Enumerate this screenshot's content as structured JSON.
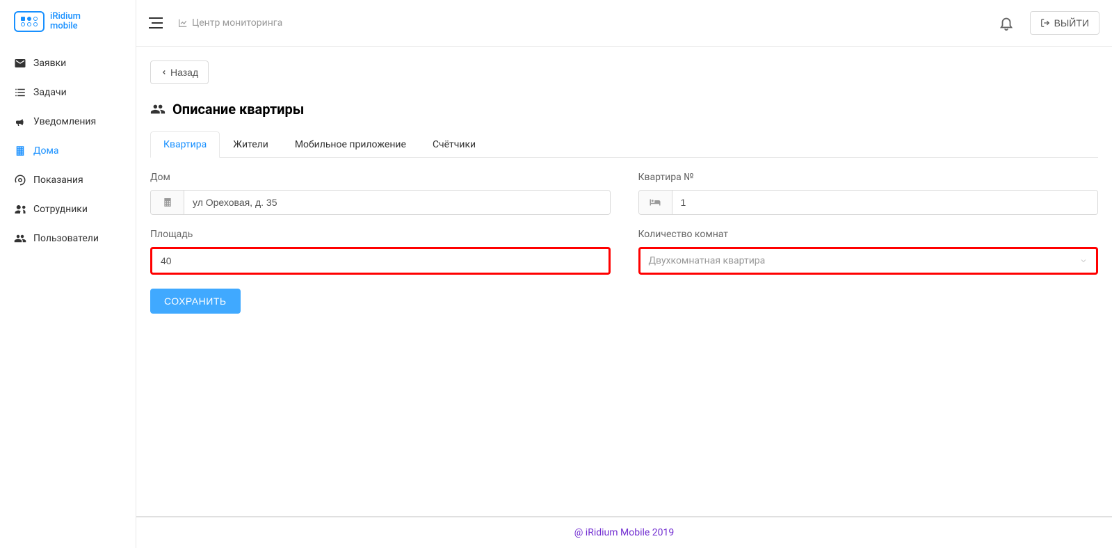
{
  "brand": {
    "line1": "iRidium",
    "line2": "mobile"
  },
  "sidebar": {
    "items": [
      {
        "label": "Заявки"
      },
      {
        "label": "Задачи"
      },
      {
        "label": "Уведомления"
      },
      {
        "label": "Дома"
      },
      {
        "label": "Показания"
      },
      {
        "label": "Сотрудники"
      },
      {
        "label": "Пользователи"
      }
    ]
  },
  "topbar": {
    "monitor_label": "Центр мониторинга",
    "logout_label": "ВЫЙТИ"
  },
  "page": {
    "back_label": "Назад",
    "title": "Описание квартиры",
    "tabs": [
      {
        "label": "Квартира"
      },
      {
        "label": "Жители"
      },
      {
        "label": "Мобильное приложение"
      },
      {
        "label": "Счётчики"
      }
    ],
    "form": {
      "house_label": "Дом",
      "house_value": "ул Ореховая, д. 35",
      "apt_label": "Квартира №",
      "apt_value": "1",
      "area_label": "Площадь",
      "area_value": "40",
      "rooms_label": "Количество комнат",
      "rooms_value": "Двухкомнатная квартира",
      "save_label": "СОХРАНИТЬ"
    }
  },
  "footer": {
    "text": "@ iRidium Mobile 2019"
  }
}
